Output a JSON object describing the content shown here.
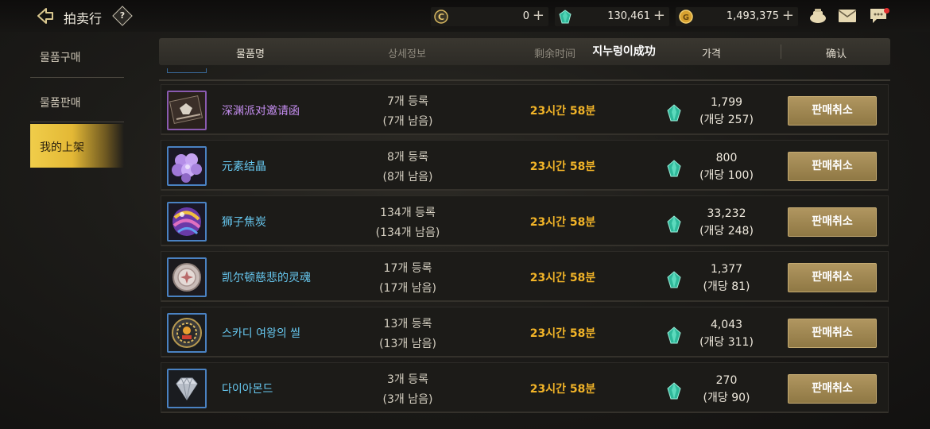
{
  "header": {
    "title": "拍卖行",
    "help_label": "?",
    "currencies": [
      {
        "icon": "coin-c-icon",
        "value": "0"
      },
      {
        "icon": "green-gem-icon",
        "value": "130,461"
      },
      {
        "icon": "gold-coin-icon",
        "value": "1,493,375"
      }
    ],
    "plus_label": "+"
  },
  "sidebar": {
    "items": [
      {
        "label": "물품구매"
      },
      {
        "label": "물품판매"
      },
      {
        "label": "我的上架"
      }
    ]
  },
  "table": {
    "columns": [
      "물품명",
      "상세정보",
      "剩余时间",
      "지누렁이成功",
      "가격",
      "确认"
    ],
    "rows": [
      {
        "name": "深渊派对邀请函",
        "rarity": "purple",
        "count": "7개 등록",
        "remain": "(7개 남음)",
        "time": "23시간 58분",
        "price": "1,799",
        "unit": "(개당 257)",
        "action": "판매취소",
        "icon": "invitation-card-icon"
      },
      {
        "name": "元素结晶",
        "rarity": "blue",
        "count": "8개 등록",
        "remain": "(8개 남음)",
        "time": "23시간 58분",
        "price": "800",
        "unit": "(개당 100)",
        "action": "판매취소",
        "icon": "crystal-cluster-icon"
      },
      {
        "name": "狮子焦炭",
        "rarity": "blue",
        "count": "134개 등록",
        "remain": "(134개 남음)",
        "time": "23시간 58분",
        "price": "33,232",
        "unit": "(개당 248)",
        "action": "판매취소",
        "icon": "swirl-orb-icon"
      },
      {
        "name": "凯尔顿慈悲的灵魂",
        "rarity": "blue",
        "count": "17개 등록",
        "remain": "(17개 남음)",
        "time": "23시간 58분",
        "price": "1,377",
        "unit": "(개당 81)",
        "action": "판매취소",
        "icon": "soul-medal-icon"
      },
      {
        "name": "스카디 여왕의 씰",
        "rarity": "blue",
        "count": "13개 등록",
        "remain": "(13개 남음)",
        "time": "23시간 58분",
        "price": "4,043",
        "unit": "(개당 311)",
        "action": "판매취소",
        "icon": "queen-seal-icon"
      },
      {
        "name": "다이아몬드",
        "rarity": "blue",
        "count": "3개 등록",
        "remain": "(3개 남음)",
        "time": "23시간 58분",
        "price": "270",
        "unit": "(개당 90)",
        "action": "판매취소",
        "icon": "diamond-icon"
      }
    ]
  },
  "colors": {
    "accent_gold": "#e3b835",
    "time_orange": "#f2b428",
    "purple_item": "#c58ef0",
    "blue_item": "#67c8f0"
  }
}
